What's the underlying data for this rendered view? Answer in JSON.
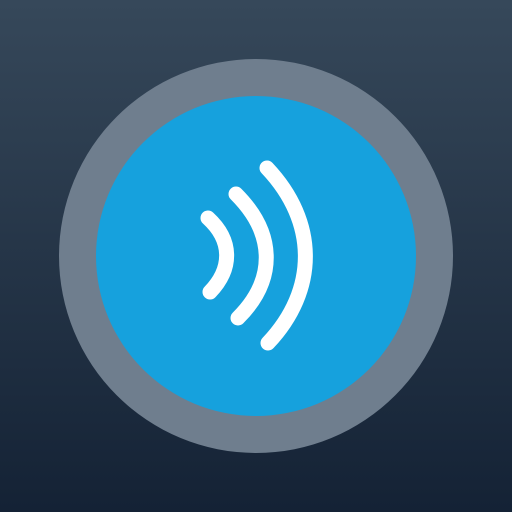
{
  "colors": {
    "background_top": "#36485a",
    "background_bottom": "#142235",
    "ring": "#6f7e8e",
    "button": "#16a1dd",
    "waves": "#ffffff"
  },
  "icon": {
    "name": "sound-waves-icon"
  }
}
